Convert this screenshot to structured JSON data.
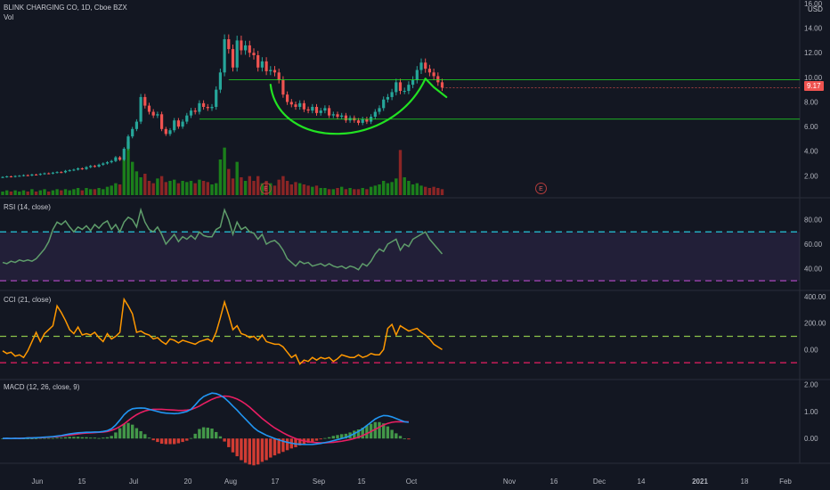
{
  "header": {
    "symbol": "BLINK CHARGING CO, 1D, Cboe BZX",
    "vol_label": "Vol",
    "currency": "USD",
    "current_price_tag": "9.17"
  },
  "colors": {
    "background": "#131722",
    "up": "#26a69a",
    "down": "#ef5350",
    "vol_up": "#1b7f1b",
    "vol_down": "#8b2525",
    "drawing": "#22e222",
    "rsi_line": "#5f9d6b",
    "rsi_band": "#7e57c2",
    "rsi_upper": "#26c6da",
    "rsi_lower": "#ab47bc",
    "cci_line": "#ff9800",
    "cci_upper": "#8bc34a",
    "cci_lower": "#e91e63",
    "macd_line": "#2196f3",
    "signal_line": "#e91e63",
    "hist_up": "#4caf50",
    "hist_down": "#f44336"
  },
  "chart_data": [
    {
      "type": "candlestick",
      "title": "BLINK CHARGING CO, 1D, Cboe BZX",
      "ylim": [
        0.5,
        16
      ],
      "ticks": [
        "2.00",
        "4.00",
        "6.00",
        "8.00",
        "10.00",
        "12.00",
        "14.00",
        "16.00"
      ],
      "closes": [
        1.9,
        1.95,
        1.92,
        1.98,
        2.0,
        2.05,
        2.02,
        2.1,
        2.08,
        2.15,
        2.2,
        2.18,
        2.25,
        2.3,
        2.28,
        2.4,
        2.45,
        2.5,
        2.6,
        2.55,
        2.7,
        2.8,
        2.75,
        2.9,
        3.0,
        3.1,
        3.2,
        3.5,
        3.3,
        4.2,
        5.2,
        5.8,
        6.4,
        8.4,
        7.7,
        7.2,
        6.9,
        7.0,
        5.8,
        5.4,
        5.7,
        6.5,
        6.0,
        6.4,
        6.9,
        7.3,
        7.2,
        7.9,
        7.6,
        7.5,
        7.6,
        9.0,
        10.4,
        13.1,
        12.3,
        10.8,
        13.0,
        12.2,
        12.6,
        12.0,
        11.8,
        10.8,
        11.3,
        10.5,
        10.6,
        10.4,
        9.8,
        8.6,
        8.0,
        7.8,
        7.6,
        7.9,
        7.4,
        7.3,
        7.6,
        7.1,
        7.3,
        7.5,
        6.9,
        7.0,
        6.8,
        6.9,
        6.5,
        6.7,
        6.5,
        6.3,
        6.6,
        6.4,
        6.8,
        7.2,
        7.5,
        8.2,
        8.4,
        8.8,
        9.6,
        8.9,
        8.9,
        9.4,
        9.8,
        10.6,
        11.2,
        10.7,
        10.4,
        10.1,
        9.6,
        9.17
      ],
      "volumes": [
        3,
        4,
        3,
        4,
        3,
        4,
        3,
        5,
        3,
        4,
        5,
        3,
        4,
        5,
        4,
        5,
        4,
        5,
        6,
        4,
        6,
        5,
        5,
        6,
        5,
        7,
        8,
        10,
        9,
        30,
        45,
        28,
        20,
        15,
        18,
        12,
        10,
        14,
        16,
        11,
        12,
        13,
        10,
        12,
        11,
        12,
        10,
        13,
        12,
        11,
        9,
        10,
        30,
        40,
        22,
        14,
        28,
        15,
        12,
        16,
        12,
        16,
        10,
        12,
        10,
        8,
        13,
        16,
        12,
        9,
        11,
        10,
        9,
        8,
        7,
        8,
        6,
        6,
        5,
        5,
        6,
        7,
        5,
        6,
        5,
        5,
        6,
        5,
        7,
        8,
        9,
        12,
        10,
        11,
        14,
        38,
        15,
        12,
        9,
        10,
        8,
        7,
        6,
        7,
        6,
        5
      ],
      "horizontal_levels": [
        9.8,
        6.6
      ],
      "earnings_markers": [
        "E",
        "E"
      ]
    },
    {
      "type": "line",
      "title": "RSI (14, close)",
      "ylim": [
        25,
        95
      ],
      "ticks": [
        "40.00",
        "60.00",
        "80.00"
      ],
      "upper": 70,
      "lower": 30,
      "values": [
        45,
        44,
        46,
        45,
        47,
        46,
        47,
        46,
        48,
        52,
        56,
        62,
        72,
        78,
        76,
        79,
        74,
        70,
        74,
        72,
        75,
        71,
        76,
        73,
        77,
        79,
        72,
        76,
        70,
        78,
        82,
        80,
        74,
        88,
        78,
        72,
        70,
        74,
        68,
        60,
        64,
        68,
        62,
        66,
        64,
        67,
        64,
        70,
        67,
        66,
        66,
        72,
        74,
        88,
        80,
        68,
        78,
        72,
        74,
        70,
        69,
        64,
        68,
        60,
        62,
        63,
        60,
        55,
        48,
        45,
        42,
        46,
        44,
        45,
        42,
        43,
        44,
        42,
        44,
        42,
        41,
        42,
        40,
        42,
        41,
        39,
        44,
        42,
        46,
        52,
        56,
        54,
        60,
        62,
        64,
        55,
        60,
        58,
        64,
        66,
        68,
        70,
        64,
        60,
        56,
        52
      ]
    },
    {
      "type": "line",
      "title": "CCI (21, close)",
      "ylim": [
        -200,
        420
      ],
      "ticks": [
        "0.00",
        "200.00",
        "400.00"
      ],
      "upper": 100,
      "lower": -100,
      "values": [
        -10,
        -30,
        -20,
        -50,
        -40,
        -60,
        -10,
        60,
        130,
        60,
        120,
        150,
        180,
        330,
        280,
        220,
        150,
        120,
        170,
        110,
        120,
        110,
        130,
        90,
        60,
        120,
        80,
        100,
        130,
        380,
        330,
        270,
        130,
        140,
        120,
        110,
        80,
        90,
        60,
        40,
        80,
        70,
        50,
        70,
        60,
        50,
        40,
        60,
        70,
        80,
        60,
        130,
        240,
        360,
        260,
        150,
        180,
        120,
        110,
        90,
        100,
        70,
        110,
        60,
        50,
        40,
        40,
        20,
        -20,
        -60,
        -40,
        -110,
        -80,
        -90,
        -60,
        -80,
        -60,
        -70,
        -60,
        -90,
        -70,
        -40,
        -50,
        -60,
        -60,
        -40,
        -60,
        -50,
        -30,
        -40,
        -40,
        0,
        160,
        190,
        110,
        180,
        160,
        140,
        150,
        160,
        130,
        110,
        80,
        40,
        20,
        0
      ]
    },
    {
      "type": "line",
      "title": "MACD (12, 26, close, 9)",
      "ylim": [
        -0.85,
        2.05
      ],
      "ticks": [
        "0.00",
        "1.00",
        "2.00"
      ],
      "macd": [
        0.0,
        0.01,
        0.0,
        0.01,
        0.0,
        0.01,
        0.02,
        0.02,
        0.03,
        0.04,
        0.05,
        0.06,
        0.07,
        0.09,
        0.11,
        0.14,
        0.17,
        0.19,
        0.21,
        0.22,
        0.23,
        0.23,
        0.24,
        0.24,
        0.26,
        0.29,
        0.36,
        0.5,
        0.68,
        0.88,
        1.02,
        1.1,
        1.12,
        1.13,
        1.12,
        1.08,
        1.04,
        1.0,
        0.96,
        0.94,
        0.93,
        0.92,
        0.93,
        0.96,
        1.0,
        1.08,
        1.24,
        1.42,
        1.55,
        1.62,
        1.68,
        1.66,
        1.6,
        1.5,
        1.36,
        1.2,
        1.05,
        0.88,
        0.72,
        0.56,
        0.4,
        0.28,
        0.2,
        0.12,
        0.06,
        0.0,
        -0.05,
        -0.1,
        -0.14,
        -0.17,
        -0.2,
        -0.21,
        -0.22,
        -0.22,
        -0.22,
        -0.2,
        -0.18,
        -0.15,
        -0.12,
        -0.08,
        -0.04,
        0.0,
        0.04,
        0.1,
        0.18,
        0.26,
        0.36,
        0.48,
        0.6,
        0.72,
        0.8,
        0.85,
        0.84,
        0.8,
        0.74,
        0.68,
        0.62,
        0.6
      ],
      "signal": [
        0.0,
        0.0,
        0.0,
        0.0,
        0.01,
        0.01,
        0.02,
        0.02,
        0.03,
        0.03,
        0.04,
        0.05,
        0.06,
        0.07,
        0.09,
        0.11,
        0.13,
        0.15,
        0.17,
        0.19,
        0.2,
        0.21,
        0.22,
        0.23,
        0.24,
        0.26,
        0.3,
        0.36,
        0.44,
        0.54,
        0.66,
        0.78,
        0.88,
        0.96,
        1.02,
        1.06,
        1.08,
        1.08,
        1.08,
        1.07,
        1.06,
        1.05,
        1.04,
        1.04,
        1.05,
        1.07,
        1.13,
        1.2,
        1.29,
        1.37,
        1.45,
        1.51,
        1.55,
        1.57,
        1.56,
        1.52,
        1.46,
        1.38,
        1.28,
        1.16,
        1.02,
        0.88,
        0.74,
        0.62,
        0.5,
        0.39,
        0.3,
        0.21,
        0.13,
        0.06,
        0.0,
        -0.05,
        -0.09,
        -0.12,
        -0.14,
        -0.15,
        -0.16,
        -0.16,
        -0.15,
        -0.14,
        -0.12,
        -0.1,
        -0.07,
        -0.04,
        0.0,
        0.05,
        0.11,
        0.18,
        0.26,
        0.34,
        0.42,
        0.5,
        0.56,
        0.6,
        0.62,
        0.62,
        0.62,
        0.62
      ]
    }
  ],
  "x_axis": {
    "labels": [
      "Jun",
      "15",
      "Jul",
      "20",
      "Aug",
      "17",
      "Sep",
      "15",
      "Oct",
      "Nov",
      "16",
      "Dec",
      "14",
      "2021",
      "18",
      "Feb"
    ]
  }
}
